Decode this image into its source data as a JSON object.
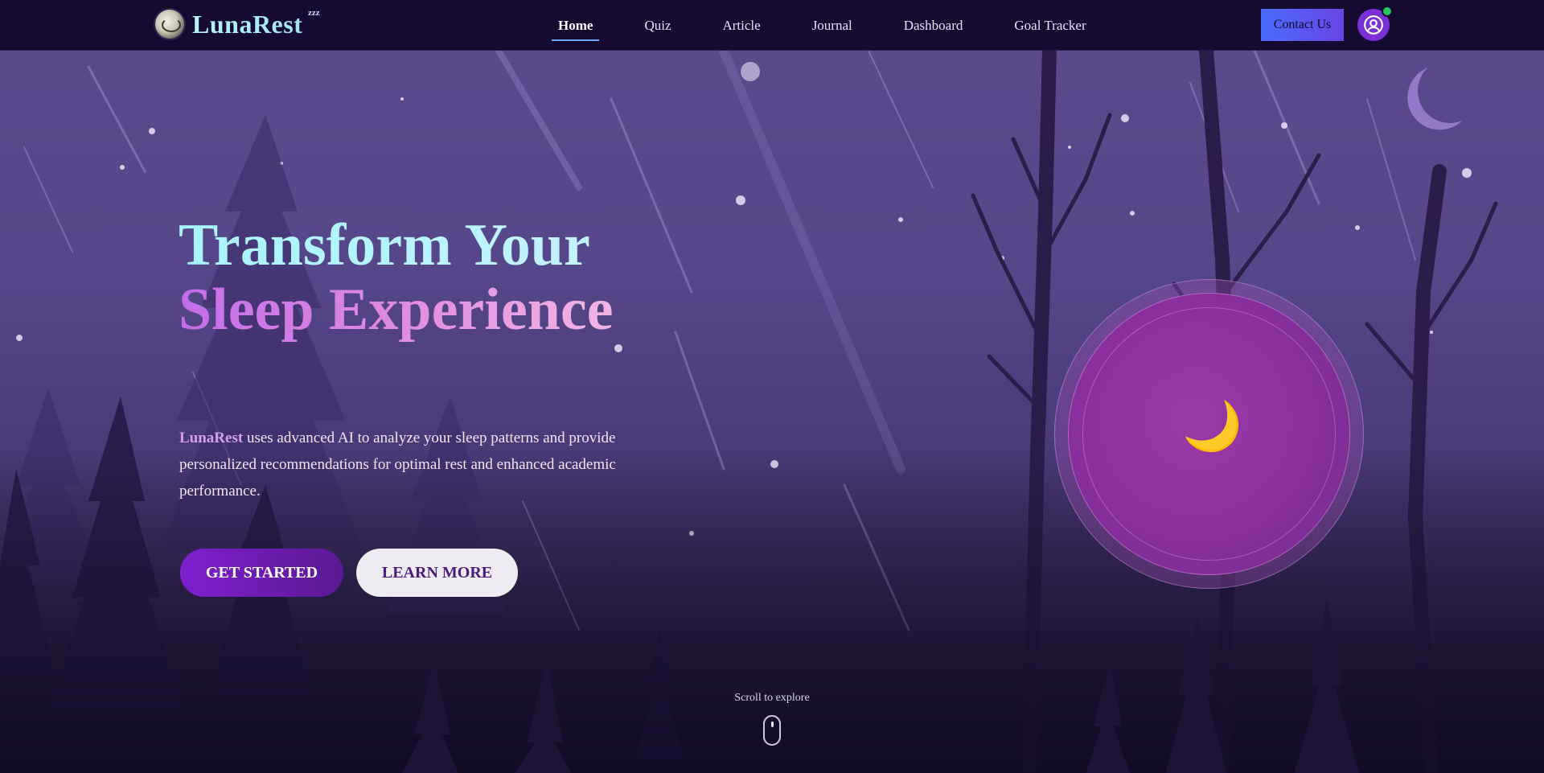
{
  "brand": {
    "name": "LunaRest",
    "badge": "zzz",
    "logo_icon": "moon-globe-logo"
  },
  "nav": {
    "items": [
      {
        "label": "Home",
        "active": true
      },
      {
        "label": "Quiz",
        "active": false
      },
      {
        "label": "Article",
        "active": false
      },
      {
        "label": "Journal",
        "active": false
      },
      {
        "label": "Dashboard",
        "active": false
      },
      {
        "label": "Goal Tracker",
        "active": false
      }
    ],
    "contact_label": "Contact Us",
    "avatar_icon": "user-circle-icon",
    "status": "online"
  },
  "hero": {
    "headline_line1": "Transform Your",
    "headline_line2": "Sleep Experience",
    "lead_brand": "LunaRest",
    "lead_text": " uses advanced AI to analyze your sleep patterns and provide personalized recommendations for optimal rest and enhanced academic performance.",
    "primary_cta": "GET STARTED",
    "secondary_cta": "LEARN MORE",
    "orb_icon": "🌙",
    "scroll_hint": "Scroll to explore"
  },
  "colors": {
    "nav_bg": "#150a30",
    "accent_blue": "#4b6cff",
    "accent_purple": "#7f1fd0",
    "status_green": "#22c55e",
    "headline_cyan": "#a8f4ff",
    "headline_pink": "#e28ee0"
  }
}
